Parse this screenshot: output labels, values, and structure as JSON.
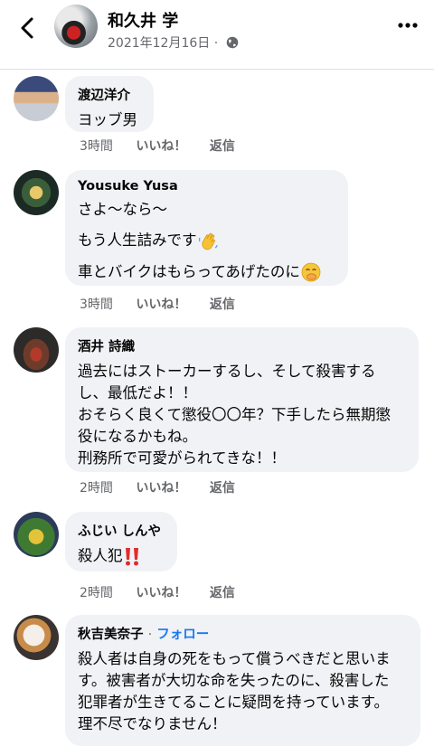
{
  "header": {
    "title": "和久井 学",
    "date": "2021年12月16日 ·",
    "icons": {
      "back": "chevron-left-icon",
      "privacy": "globe-icon",
      "more": "more-horizontal-icon"
    }
  },
  "comments": [
    {
      "author": "渡辺洋介",
      "lines": [
        "ヨッブ男"
      ],
      "time": "3時間",
      "like": "いいね！",
      "reply": "返信"
    },
    {
      "author": "Yousuke Yusa",
      "lines": [
        "さよ〜なら〜",
        "もう人生詰みです",
        "車とバイクはもらってあげたのに"
      ],
      "time": "3時間",
      "like": "いいね！",
      "reply": "返信"
    },
    {
      "author": "酒井 詩織",
      "lines": [
        "過去にはストーカーするし、そして殺害する",
        "し、最低だよ！！",
        "おそらく良くて懲役〇〇年？下手したら無期懲",
        "役になるかもね。",
        "刑務所で可愛がられてきな！！"
      ],
      "time": "2時間",
      "like": "いいね！",
      "reply": "返信"
    },
    {
      "author": "ふじい しんや",
      "lines": [
        "殺人犯"
      ],
      "time": "2時間",
      "like": "いいね！",
      "reply": "返信"
    },
    {
      "author": "秋吉美奈子",
      "follow": "フォロー",
      "lines": [
        "殺人者は自身の死をもって償うべきだと思いま",
        "す。被害者が大切な命を失ったのに、殺害した",
        "犯罪者が生きてることに疑問を持っています。",
        "理不尽でなりません！"
      ]
    }
  ],
  "emojis": [
    "waving-hand-emoji",
    "face-with-hand-over-mouth-emoji",
    "double-exclamation-emoji"
  ],
  "colors": {
    "bubble": "#f0f2f5",
    "secondary_text": "#65676b",
    "link": "#1877f2"
  }
}
